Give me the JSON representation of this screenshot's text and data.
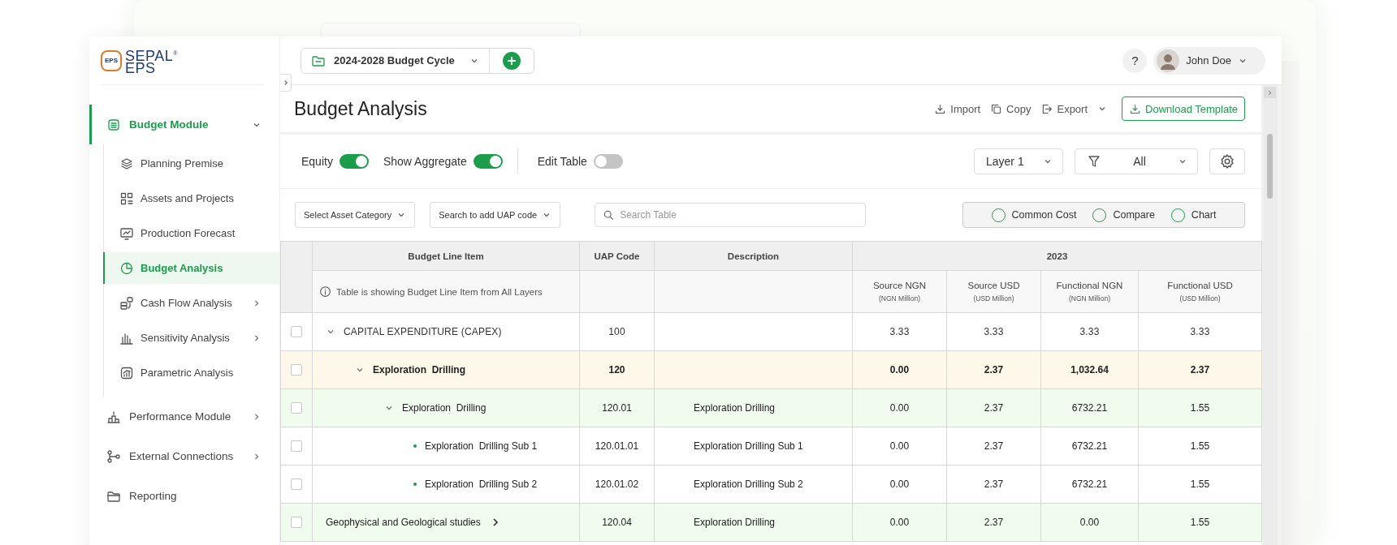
{
  "sidebar": {
    "logo": {
      "badge": "EPS",
      "line1": "SEPAL",
      "mark": "®",
      "line2": "EPS"
    },
    "items": [
      {
        "label": "Budget Module",
        "selected": true,
        "expanded": true,
        "children": [
          {
            "label": "Planning Premise",
            "selected": false
          },
          {
            "label": "Assets and Projects",
            "selected": false
          },
          {
            "label": "Production Forecast",
            "selected": false
          },
          {
            "label": "Budget Analysis",
            "selected": true
          },
          {
            "label": "Cash Flow Analysis",
            "selected": false,
            "expanded": false
          },
          {
            "label": "Sensitivity Analysis",
            "selected": false,
            "expanded": false
          },
          {
            "label": "Parametric Analysis",
            "selected": false
          }
        ]
      },
      {
        "label": "Performance Module",
        "selected": false,
        "expanded": false
      },
      {
        "label": "External Connections",
        "selected": false,
        "expanded": false
      },
      {
        "label": "Reporting",
        "selected": false
      }
    ]
  },
  "topbar": {
    "cycle": "2024-2028 Budget Cycle",
    "help": "?",
    "user": "John Doe"
  },
  "page": {
    "title": "Budget Analysis",
    "actions": [
      "Import",
      "Copy",
      "Export"
    ],
    "download": "Download Template"
  },
  "toolbar": {
    "toggles": [
      {
        "label": "Equity",
        "on": true
      },
      {
        "label": "Show Aggregate",
        "on": true
      },
      {
        "label": "Edit Table",
        "on": false
      }
    ],
    "layer": "Layer 1",
    "filter": "All",
    "asset_category": "Select Asset Category",
    "uap_search": "Search to add UAP code",
    "search": {
      "placeholder": "Search Table"
    },
    "options": [
      {
        "label": "Common Cost",
        "selected": false
      },
      {
        "label": "Compare",
        "selected": false
      },
      {
        "label": "Chart",
        "selected": false
      }
    ]
  },
  "table": {
    "columns": [
      "Budget Line Item",
      "UAP Code",
      "Description"
    ],
    "year": "2023",
    "info": "Table is showing Budget Line Item from All Layers",
    "value_columns": [
      {
        "name": "Source NGN",
        "unit": "(NGN Million)"
      },
      {
        "name": "Source USD",
        "unit": "(USD Million)"
      },
      {
        "name": "Functional NGN",
        "unit": "(NGN Million)"
      },
      {
        "name": "Functional USD",
        "unit": "(USD Million)"
      }
    ],
    "rows": [
      {
        "checked": false,
        "kind": "section",
        "expanded": true,
        "label": "CAPITAL EXPENDITURE (CAPEX)",
        "uap": "100",
        "values": [
          "3.33",
          "3.33",
          "3.33",
          "3.33"
        ],
        "children": [
          {
            "checked": false,
            "kind": "group",
            "expanded": true,
            "label": "Exploration  Drilling",
            "uap": "120",
            "values": [
              "0.00",
              "2.37",
              "1,032.64",
              "2.37"
            ],
            "children": [
              {
                "checked": false,
                "kind": "subgroup",
                "expanded": true,
                "label": "Exploration  Drilling",
                "uap": "120.01",
                "description": "Exploration Drilling",
                "values": [
                  "0.00",
                  "2.37",
                  "6732.21",
                  "1.55"
                ],
                "children": [
                  {
                    "checked": false,
                    "kind": "item",
                    "label": "Exploration  Drilling Sub 1",
                    "uap": "120.01.01",
                    "description": "Exploration Drilling Sub 1",
                    "values": [
                      "0.00",
                      "2.37",
                      "6732.21",
                      "1.55"
                    ]
                  },
                  {
                    "checked": false,
                    "kind": "item",
                    "label": "Exploration  Drilling Sub 2",
                    "uap": "120.01.02",
                    "description": "Exploration Drilling Sub 2",
                    "values": [
                      "0.00",
                      "2.37",
                      "6732.21",
                      "1.55"
                    ]
                  }
                ]
              }
            ]
          }
        ]
      },
      {
        "checked": false,
        "kind": "subgroup",
        "expanded": false,
        "label": "Geophysical and Geological studies",
        "uap": "120.04",
        "description": "Exploration Drilling",
        "values": [
          "0.00",
          "2.37",
          "0.00",
          "1.55"
        ]
      }
    ]
  }
}
